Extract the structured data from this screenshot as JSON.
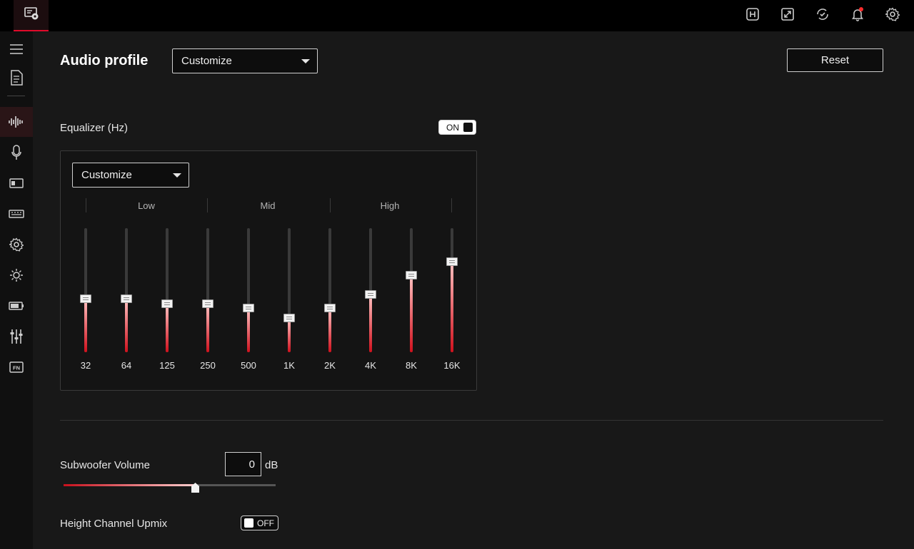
{
  "topbar": {
    "icons": [
      "app-icon",
      "macro-h-icon",
      "screen-expand-icon",
      "sync-check-icon",
      "bell-icon",
      "gear-icon"
    ]
  },
  "sidebar": {
    "items": [
      "menu-icon",
      "document-icon",
      "audio-wave-icon",
      "microphone-icon",
      "display-icon",
      "keyboard-icon",
      "gear-icon",
      "lighting-icon",
      "battery-icon",
      "mixer-icon",
      "fn-key-icon"
    ],
    "active": "audio-wave-icon",
    "fn_text": "FN"
  },
  "audio_profile": {
    "title": "Audio profile",
    "selected": "Customize"
  },
  "reset_label": "Reset",
  "equalizer": {
    "label": "Equalizer (Hz)",
    "toggle_label": "ON",
    "preset": "Customize",
    "groups": [
      "Low",
      "Mid",
      "High"
    ],
    "bands": [
      {
        "freq": "32",
        "level": 0.46
      },
      {
        "freq": "64",
        "level": 0.46
      },
      {
        "freq": "125",
        "level": 0.42
      },
      {
        "freq": "250",
        "level": 0.42
      },
      {
        "freq": "500",
        "level": 0.38
      },
      {
        "freq": "1K",
        "level": 0.29
      },
      {
        "freq": "2K",
        "level": 0.38
      },
      {
        "freq": "4K",
        "level": 0.5
      },
      {
        "freq": "8K",
        "level": 0.67
      },
      {
        "freq": "16K",
        "level": 0.79
      }
    ]
  },
  "subwoofer": {
    "label": "Subwoofer Volume",
    "value": "0",
    "unit": "dB",
    "level": 0.62
  },
  "upmix": {
    "label": "Height Channel Upmix",
    "toggle_label": "OFF"
  },
  "colors": {
    "accent": "#e00a2a",
    "background": "#181818",
    "sidebar": "#101010"
  }
}
